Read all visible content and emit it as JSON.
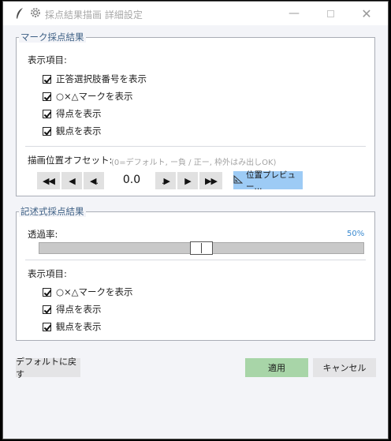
{
  "window": {
    "title": "採点結果描画 詳細設定"
  },
  "mark_group": {
    "title": "マーク採点結果",
    "display_label": "表示項目:",
    "checkboxes": [
      {
        "label": "正答選択肢番号を表示",
        "checked": true
      },
      {
        "label": "○×△マークを表示",
        "checked": true
      },
      {
        "label": "得点を表示",
        "checked": true
      },
      {
        "label": "観点を表示",
        "checked": true
      }
    ],
    "offset_label": "描画位置オフセット:",
    "offset_hint": "(0=デフォルト, ー負 / 正ー, 枠外はみ出しOK)",
    "offset_value": "0.0",
    "preview_label": "位置プレビュー..."
  },
  "written_group": {
    "title": "記述式採点結果",
    "transparency_label": "透過率:",
    "transparency_text": "50%",
    "transparency_value": 0.5,
    "display_label": "表示項目:",
    "checkboxes": [
      {
        "label": "○×△マークを表示",
        "checked": true
      },
      {
        "label": "得点を表示",
        "checked": true
      },
      {
        "label": "観点を表示",
        "checked": true
      }
    ]
  },
  "footer": {
    "reset_label": "デフォルトに戻す",
    "apply_label": "適用",
    "cancel_label": "キャンセル"
  },
  "colors": {
    "accent_blue": "#9dcbf5",
    "apply_green": "#a8d5a8",
    "group_title": "#3d5f84",
    "percent": "#3a8ad0"
  }
}
